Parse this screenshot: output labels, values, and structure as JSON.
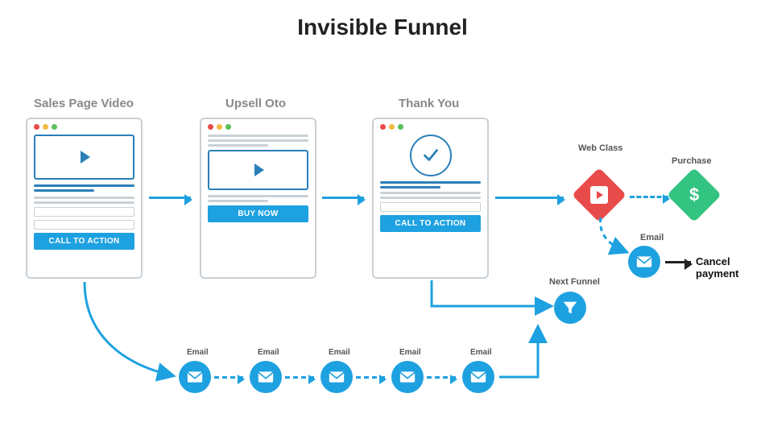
{
  "title": "Invisible Funnel",
  "pages": {
    "sales": {
      "label": "Sales Page Video",
      "cta": "CALL TO ACTION"
    },
    "upsell": {
      "label": "Upsell Oto",
      "cta": "BUY NOW"
    },
    "thankyou": {
      "label": "Thank You",
      "cta": "CALL TO ACTION"
    }
  },
  "nodes": {
    "web_class": "Web Class",
    "purchase": "Purchase",
    "email": "Email",
    "cancel": "Cancel payment",
    "next_funnel": "Next Funnel"
  },
  "email_sequence": [
    "Email",
    "Email",
    "Email",
    "Email",
    "Email"
  ]
}
